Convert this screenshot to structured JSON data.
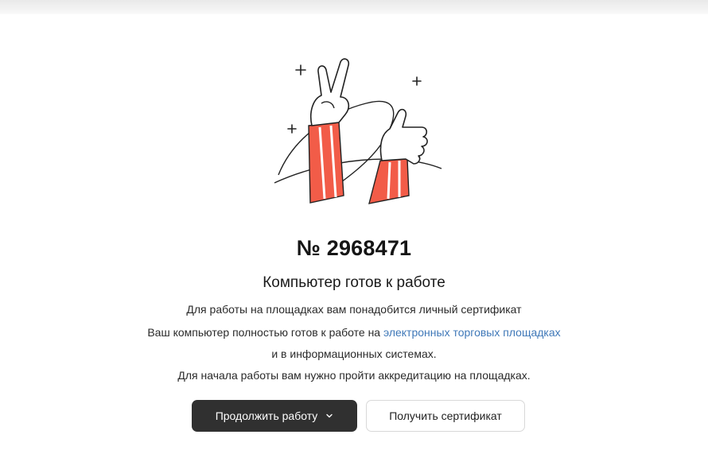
{
  "order": {
    "number": "№ 2968471"
  },
  "status": {
    "title": "Компьютер готов к работе"
  },
  "description": {
    "line1": "Для работы на площадках вам понадобится личный сертификат",
    "line2_prefix": "Ваш компьютер полностью готов к работе на ",
    "line2_link": "электронных торговых площадках",
    "line3": "и в информационных системах.",
    "line4": "Для начала работы вам нужно пройти аккредитацию на площадках."
  },
  "actions": {
    "continue_label": "Продолжить работу",
    "certificate_label": "Получить сертификат"
  },
  "colors": {
    "accent_red": "#f25c48",
    "link_blue": "#3f78b8",
    "primary_button": "#303030"
  },
  "icons": {
    "illustration": "victory-and-thumbs-up-hands-illustration",
    "chevron": "chevron-down-icon"
  }
}
